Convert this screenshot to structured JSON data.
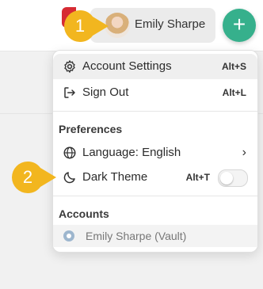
{
  "header": {
    "user_name": "Emily Sharpe",
    "add_label": "+"
  },
  "annotations": [
    "1",
    "2"
  ],
  "menu": {
    "account_settings": {
      "label": "Account Settings",
      "shortcut": "Alt+S"
    },
    "sign_out": {
      "label": "Sign Out",
      "shortcut": "Alt+L"
    },
    "preferences_heading": "Preferences",
    "language": {
      "label": "Language: English"
    },
    "dark_theme": {
      "label": "Dark Theme",
      "shortcut": "Alt+T",
      "enabled": false
    },
    "accounts_heading": "Accounts",
    "account_entry": "Emily Sharpe (Vault)"
  },
  "colors": {
    "accent": "#36b08c",
    "marker": "#f2b61f"
  }
}
